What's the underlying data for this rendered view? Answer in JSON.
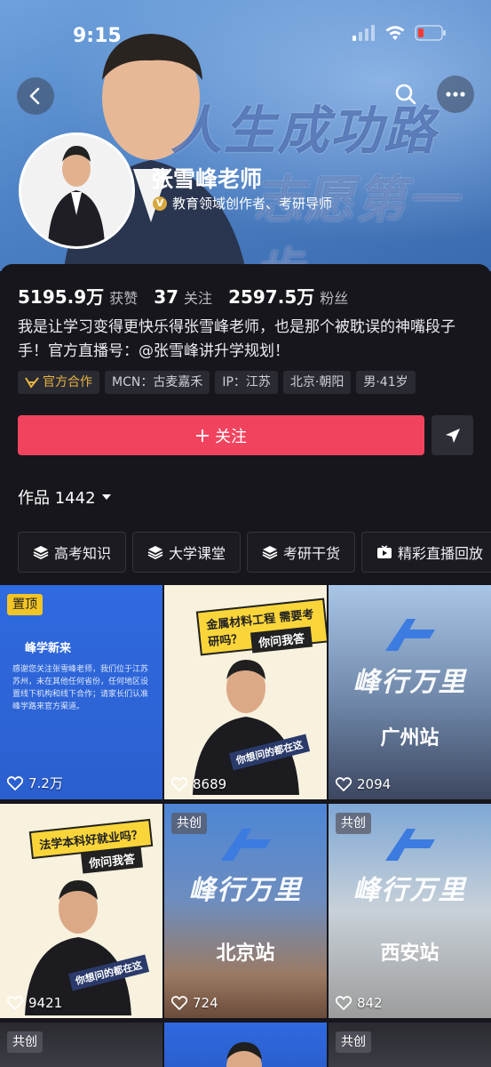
{
  "status_bar": {
    "time": "9:15"
  },
  "banner": {
    "slogan_line1": "人生成功路",
    "slogan_line2": "志愿第一步"
  },
  "profile": {
    "name": "张雪峰老师",
    "verify_text": "教育领域创作者、考研导师",
    "stats": [
      {
        "value": "5195.9万",
        "label": "获赞"
      },
      {
        "value": "37",
        "label": "关注"
      },
      {
        "value": "2597.5万",
        "label": "粉丝"
      }
    ],
    "bio": "我是让学习变得更快乐得张雪峰老师，也是那个被耽误的神嘴段子手！官方直播号：@张雪峰讲升学规划！",
    "tags": [
      "官方合作",
      "MCN：古麦嘉禾",
      "IP：江苏",
      "北京·朝阳",
      "男·41岁"
    ],
    "follow_label": "关注",
    "works_label": "作品 1442"
  },
  "filters": [
    "高考知识",
    "大学课堂",
    "考研干货",
    "精彩直播回放"
  ],
  "grid": {
    "tiles": [
      {
        "badge": "置顶",
        "likes": "7.2万",
        "brand": "峰学新来",
        "body": "感谢您关注张雪峰老师，我们位于江苏苏州，未在其他任何省份，任何地区设置线下机构和线下合作；请家长们认准峰学路来官方渠道。"
      },
      {
        "likes": "8689",
        "bubble": "金属材料工程 需要考研吗？",
        "sub": "你问我答",
        "caption": "你想问的都在这"
      },
      {
        "likes": "2094",
        "brand": "峰行万里",
        "station": "广州站"
      },
      {
        "likes": "9421",
        "bubble": "法学本科好就业吗？",
        "sub": "你问我答",
        "caption": "你想问的都在这"
      },
      {
        "badge": "共创",
        "likes": "724",
        "brand": "峰行万里",
        "station": "北京站"
      },
      {
        "badge": "共创",
        "likes": "842",
        "brand": "峰行万里",
        "station": "西安站"
      },
      {
        "badge": "共创"
      },
      {},
      {
        "badge": "共创"
      }
    ]
  }
}
